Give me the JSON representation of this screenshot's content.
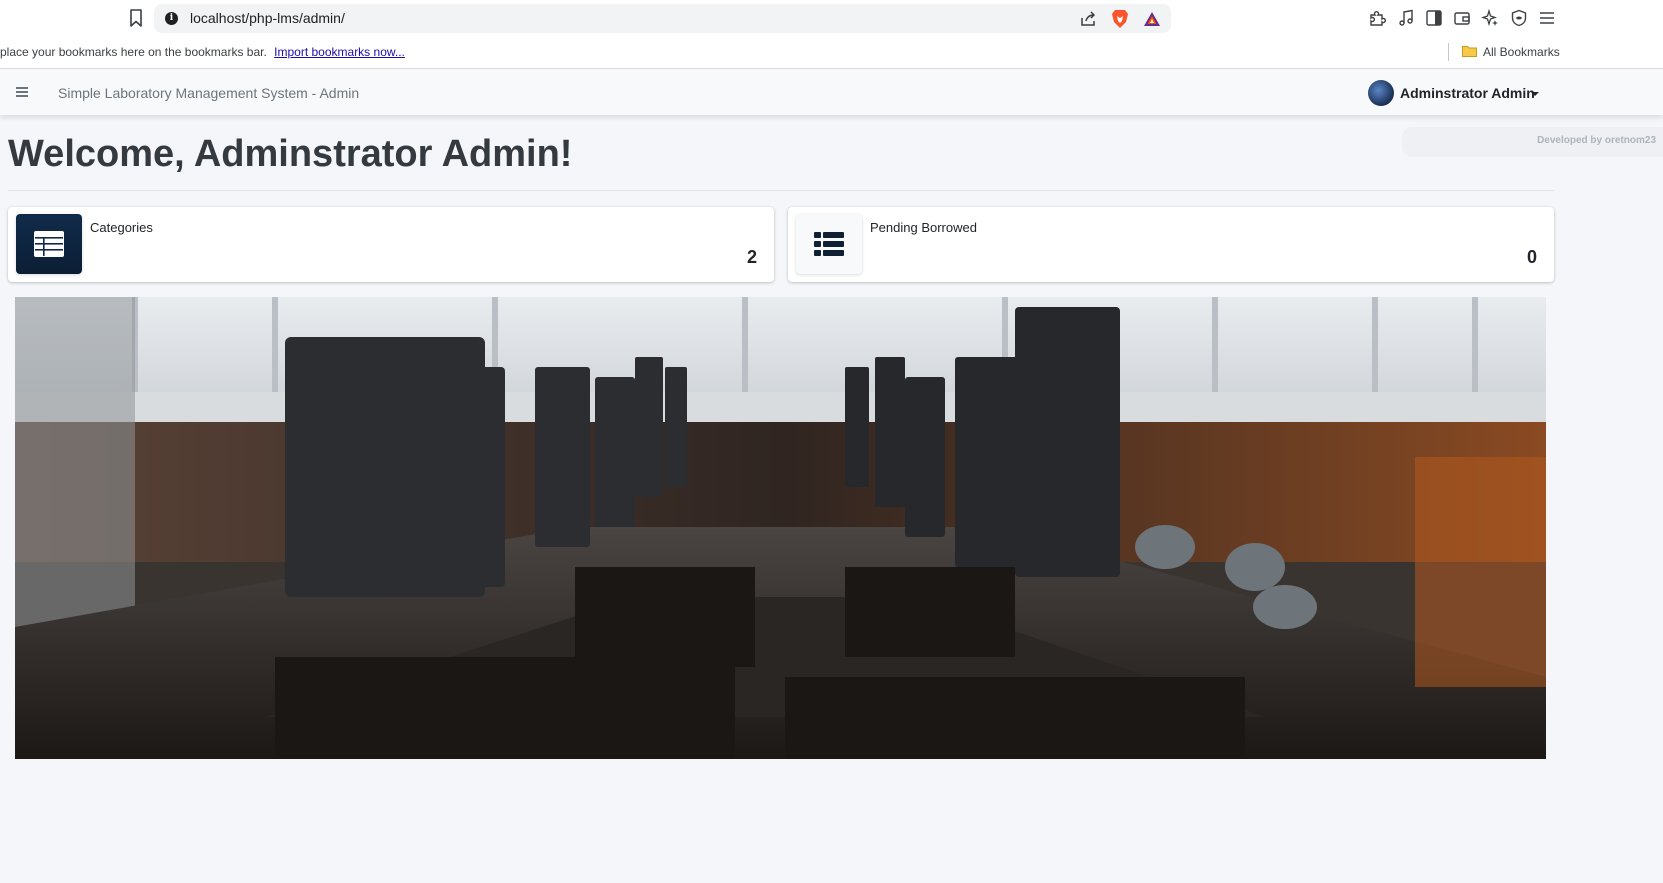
{
  "browser": {
    "url": "localhost/php-lms/admin/",
    "bookmarks_prompt": "place your bookmarks here on the bookmarks bar.",
    "import_link": "Import bookmarks now...",
    "all_bookmarks": "All Bookmarks"
  },
  "navbar": {
    "title": "Simple Laboratory Management System - Admin",
    "user_name": "Adminstrator Admin"
  },
  "developer_credit": "Developed by oretnom23",
  "page": {
    "welcome": "Welcome, Adminstrator Admin!"
  },
  "info_boxes": [
    {
      "label": "Categories",
      "value": "2"
    },
    {
      "label": "Pending Borrowed",
      "value": "0"
    }
  ],
  "icons": {
    "bookmark": "bookmark-icon",
    "info": "info-icon",
    "share": "share-icon",
    "brave": "brave-shield-icon",
    "rewards": "brave-rewards-icon",
    "extensions": "puzzle-icon",
    "media": "music-note-icon",
    "sidebar": "sidebar-icon",
    "wallet": "wallet-icon",
    "leo": "sparkle-icon",
    "vpn": "shield-icon",
    "menu": "menu-icon",
    "folder": "folder-icon",
    "hamburger": "hamburger-icon",
    "box_icon": "table-list-icon"
  },
  "colors": {
    "primary_dark": "#0f2a48",
    "brave_orange": "#fb542b",
    "page_bg": "#f4f6f9"
  }
}
